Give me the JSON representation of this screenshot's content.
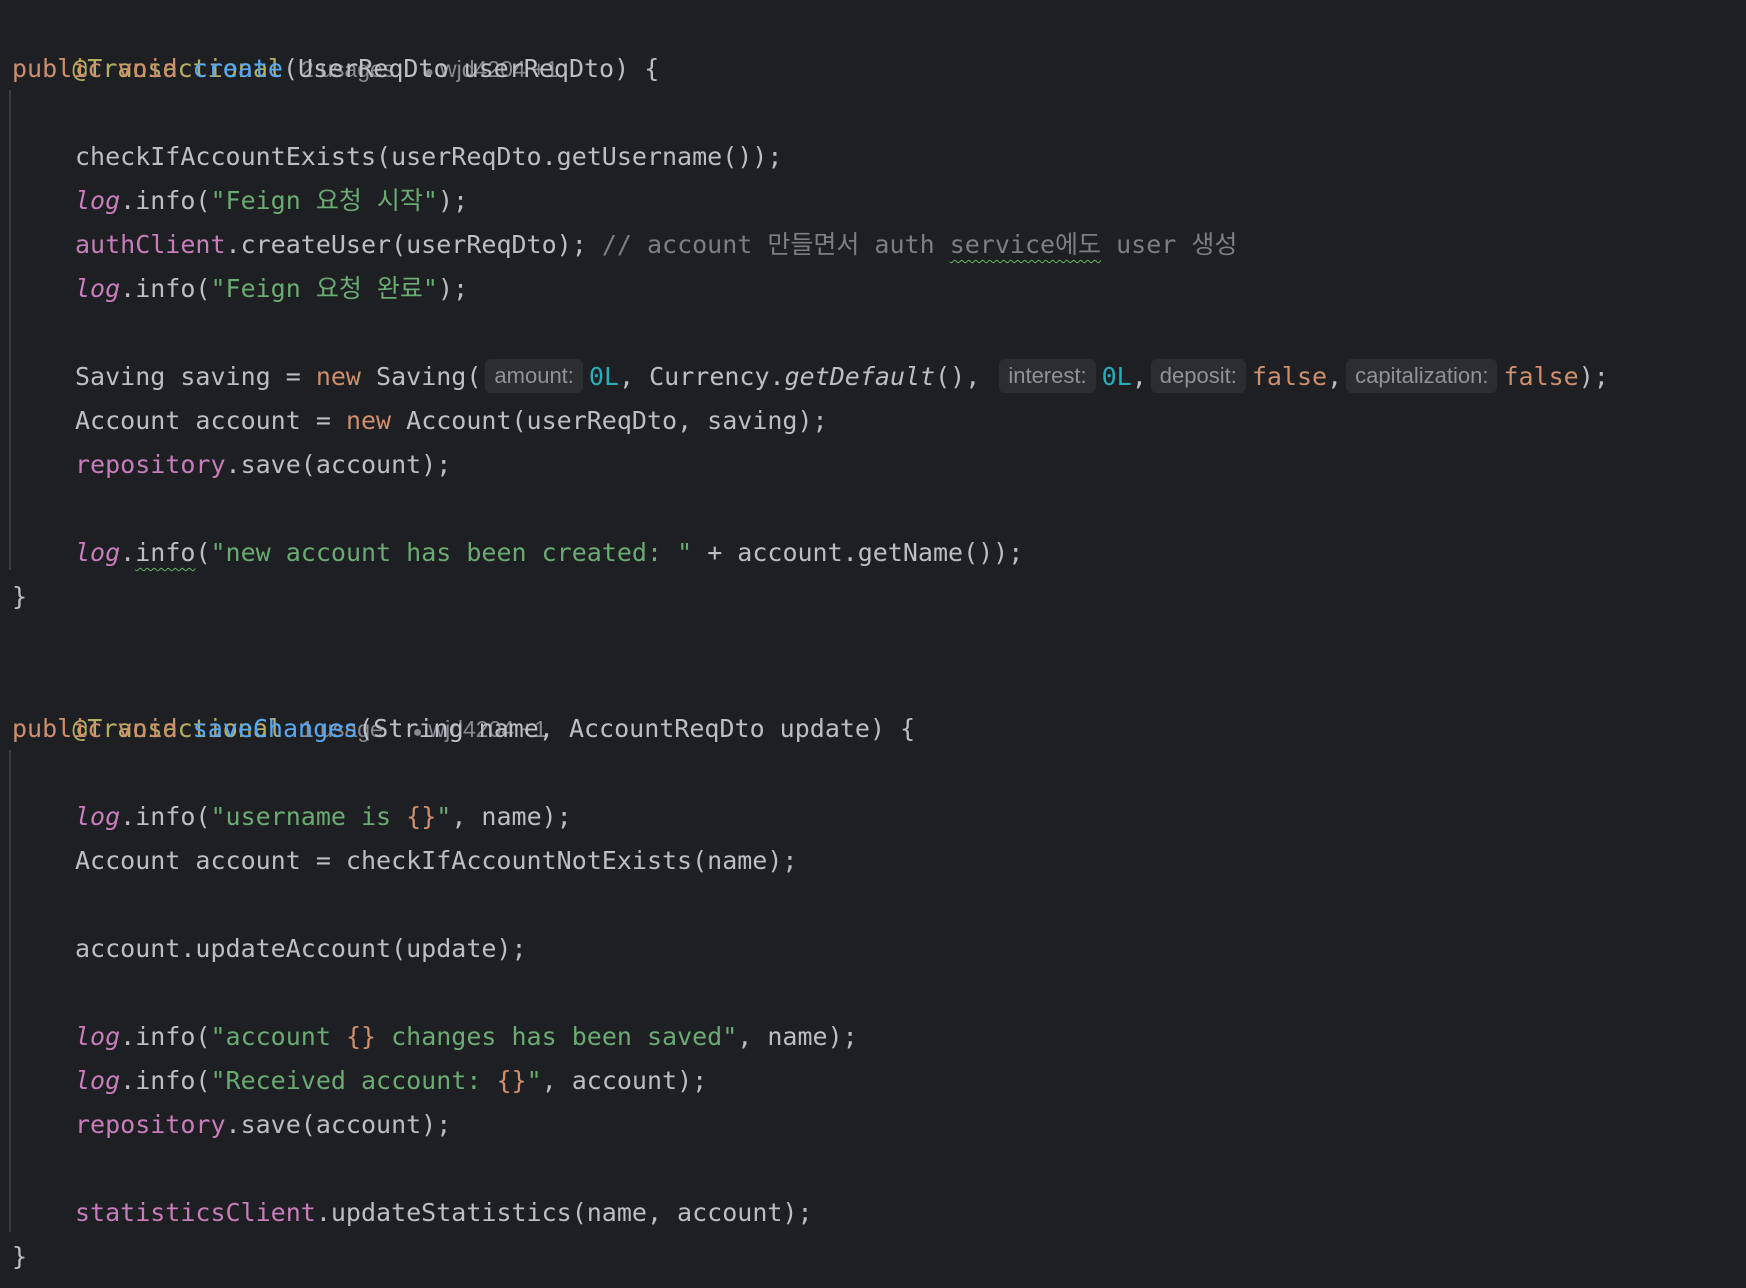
{
  "methods": [
    {
      "annotation": "@Transactional",
      "usages": "2 usages",
      "author": "wjd4204 +1",
      "signature": {
        "kw_public": "public",
        "kw_void": "void",
        "name": "create",
        "params": "(UserReqDto userReqDto) {"
      },
      "lines": {
        "l1": "checkIfAccountExists(userReqDto.getUsername());",
        "l2_log": "log",
        "l2_call": ".info(",
        "l2_str": "\"Feign 요청 시작\"",
        "l2_end": ");",
        "l3_fld": "authClient",
        "l3_call": ".createUser(userReqDto); ",
        "l3_cmt_a": "// account 만들면서 auth ",
        "l3_cmt_typo": "service에도",
        "l3_cmt_b": " user 생성",
        "l4_log": "log",
        "l4_call": ".info(",
        "l4_str": "\"Feign 요청 완료\"",
        "l4_end": ");",
        "l5_a": "Saving saving = ",
        "l5_new": "new",
        "l5_b": " Saving(",
        "l5_hint_amount": "amount:",
        "l5_amount": "0L",
        "l5_c": ", Currency.",
        "l5_default": "getDefault",
        "l5_d": "(), ",
        "l5_hint_interest": "interest:",
        "l5_interest": "0L",
        "l5_e": ",",
        "l5_hint_deposit": "deposit:",
        "l5_deposit": "false",
        "l5_f": ",",
        "l5_hint_cap": "capitalization:",
        "l5_cap": "false",
        "l5_end": ");",
        "l6_a": "Account account = ",
        "l6_new": "new",
        "l6_b": " Account(userReqDto, saving);",
        "l7_fld": "repository",
        "l7_call": ".save(account);",
        "l8_log": "log",
        "l8_dot": ".",
        "l8_info": "info",
        "l8_paren": "(",
        "l8_str": "\"new account has been created: \"",
        "l8_end": " + account.getName());"
      },
      "close": "}"
    },
    {
      "annotation": "@Transactional",
      "usages": "1 usage",
      "author": "wjd4204 +1",
      "signature": {
        "kw_public": "public",
        "kw_void": "void",
        "name": "saveChanges",
        "params": "(String name, AccountReqDto update) {"
      },
      "lines": {
        "l1_log": "log",
        "l1_call": ".info(",
        "l1_str_a": "\"username is ",
        "l1_esc": "{}",
        "l1_str_b": "\"",
        "l1_end": ", name);",
        "l2": "Account account = checkIfAccountNotExists(name);",
        "l3": "account.updateAccount(update);",
        "l4_log": "log",
        "l4_call": ".info(",
        "l4_str_a": "\"account ",
        "l4_esc": "{}",
        "l4_str_b": " changes has been saved\"",
        "l4_end": ", name);",
        "l5_log": "log",
        "l5_call": ".info(",
        "l5_str_a": "\"Received account: ",
        "l5_esc": "{}",
        "l5_str_b": "\"",
        "l5_end": ", account);",
        "l6_fld": "repository",
        "l6_call": ".save(account);",
        "l7_fld": "statisticsClient",
        "l7_call": ".updateStatistics(name, account);"
      },
      "close": "}"
    }
  ],
  "icons": {
    "author": "person-icon"
  },
  "colors": {
    "background": "#1e1f22",
    "keyword": "#cf8e6d",
    "function": "#56a8f5",
    "string": "#6aab73",
    "field": "#c77dbb",
    "number": "#2aacb8",
    "comment": "#7a7e85",
    "annotation": "#b3ae60"
  }
}
